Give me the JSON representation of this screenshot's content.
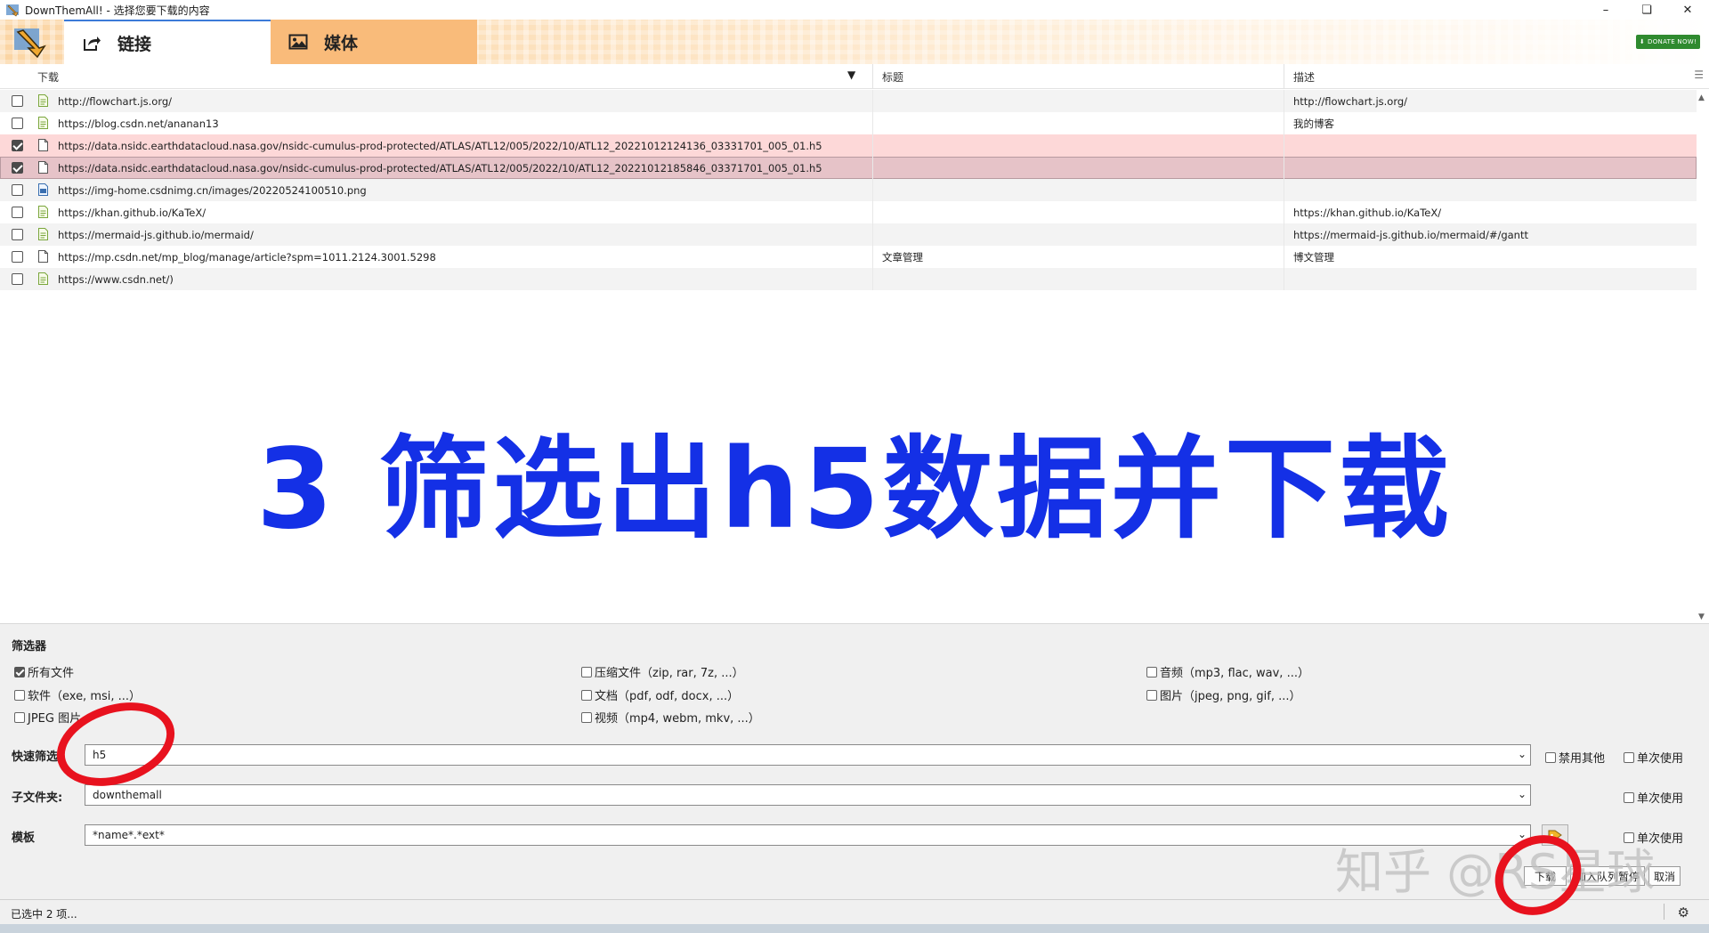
{
  "window": {
    "title": "DownThemAll! - 选择您要下载的内容"
  },
  "tabs": [
    {
      "label": "链接",
      "icon": "share-icon",
      "active": true
    },
    {
      "label": "媒体",
      "icon": "image-icon",
      "active": false
    }
  ],
  "donate_label": "DONATE NOW!",
  "table": {
    "columns": [
      "下载",
      "标题",
      "描述"
    ],
    "rows": [
      {
        "url": "http://flowchart.js.org/",
        "title": "",
        "desc": "http://flowchart.js.org/",
        "checked": false,
        "icon": "webpage-icon"
      },
      {
        "url": "https://blog.csdn.net/ananan13",
        "title": "",
        "desc": "我的博客",
        "checked": false,
        "icon": "webpage-icon"
      },
      {
        "url": "https://data.nsidc.earthdatacloud.nasa.gov/nsidc-cumulus-prod-protected/ATLAS/ATL12/005/2022/10/ATL12_20221012124136_03331701_005_01.h5",
        "title": "",
        "desc": "",
        "checked": true,
        "icon": "file-icon"
      },
      {
        "url": "https://data.nsidc.earthdatacloud.nasa.gov/nsidc-cumulus-prod-protected/ATLAS/ATL12/005/2022/10/ATL12_20221012185846_03371701_005_01.h5",
        "title": "",
        "desc": "",
        "checked": true,
        "icon": "file-icon"
      },
      {
        "url": "https://img-home.csdnimg.cn/images/20220524100510.png",
        "title": "",
        "desc": "",
        "checked": false,
        "icon": "image-file-icon"
      },
      {
        "url": "https://khan.github.io/KaTeX/",
        "title": "",
        "desc": "https://khan.github.io/KaTeX/",
        "checked": false,
        "icon": "webpage-icon"
      },
      {
        "url": "https://mermaid-js.github.io/mermaid/",
        "title": "",
        "desc": "https://mermaid-js.github.io/mermaid/#/gantt",
        "checked": false,
        "icon": "webpage-icon"
      },
      {
        "url": "https://mp.csdn.net/mp_blog/manage/article?spm=1011.2124.3001.5298",
        "title": "文章管理",
        "desc": "博文管理",
        "checked": false,
        "icon": "file-icon"
      },
      {
        "url": "https://www.csdn.net/)",
        "title": "",
        "desc": "",
        "checked": false,
        "icon": "webpage-icon"
      }
    ]
  },
  "overlay_caption": "3 筛选出h5数据并下载",
  "filters": {
    "title": "筛选器",
    "options": [
      {
        "label": "所有文件",
        "checked": true
      },
      {
        "label": "压缩文件（zip, rar, 7z, ...）",
        "checked": false
      },
      {
        "label": "音频（mp3, flac, wav, ...）",
        "checked": false
      },
      {
        "label": "软件（exe, msi, ...）",
        "checked": false
      },
      {
        "label": "文档（pdf, odf, docx, ...）",
        "checked": false
      },
      {
        "label": "图片（jpeg, png, gif, ...）",
        "checked": false
      },
      {
        "label": "JPEG 图片",
        "checked": false
      },
      {
        "label": "视频（mp4, webm, mkv, ...）",
        "checked": false
      }
    ],
    "quick_filter": {
      "label": "快速筛选",
      "value": "h5",
      "disable_others": "禁用其他",
      "once": "单次使用"
    },
    "subfolder": {
      "label": "子文件夹:",
      "value": "downthemall",
      "once": "单次使用"
    },
    "template": {
      "label": "模板",
      "value": "*name*.*ext*",
      "once": "单次使用"
    }
  },
  "buttons": {
    "download": "下载",
    "queue": "加入队列暂停",
    "cancel": "取消"
  },
  "status": {
    "text": "已选中 2 项..."
  },
  "watermark": "知乎 @RS星球",
  "colors": {
    "accent": "#3c7ad8",
    "media_tab": "#f9bb7a",
    "checked_row": "#fdd8d8",
    "caption": "#1430e6",
    "annotation": "#e8121e"
  }
}
